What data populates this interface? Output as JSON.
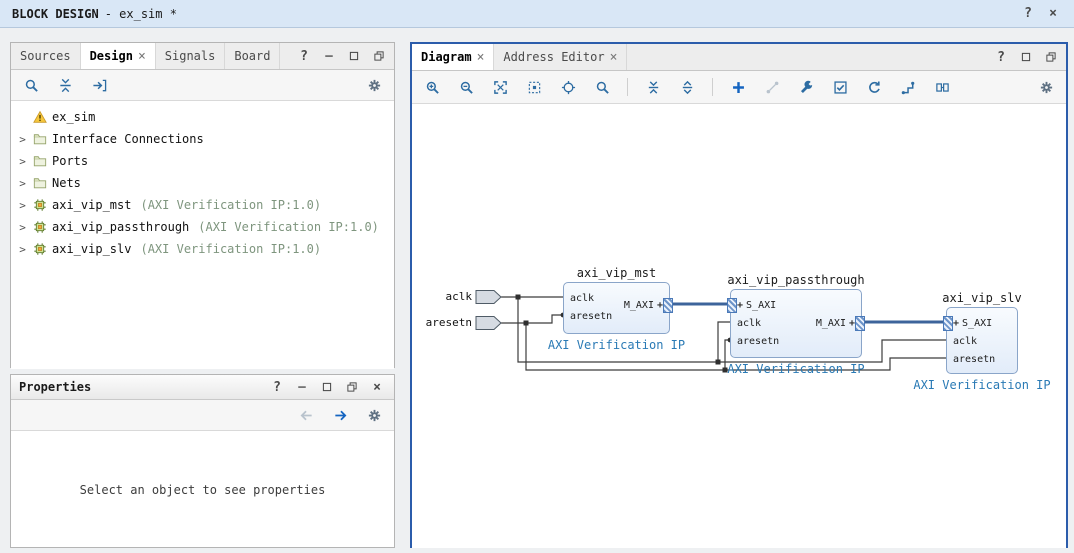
{
  "title_bar": {
    "title": "BLOCK DESIGN",
    "subtitle": "- ex_sim *",
    "controls": [
      "help-icon",
      "close-icon"
    ]
  },
  "design_panel": {
    "tabs": [
      {
        "label": "Sources",
        "active": false,
        "closable": false
      },
      {
        "label": "Design",
        "active": true,
        "closable": true
      },
      {
        "label": "Signals",
        "active": false,
        "closable": false
      },
      {
        "label": "Board",
        "active": false,
        "closable": false
      }
    ],
    "window_controls": [
      "help-icon",
      "minimize-icon",
      "maximize-icon",
      "float-icon"
    ],
    "toolbar": [
      {
        "icon": "search-icon",
        "name": "search"
      },
      {
        "icon": "collapse-all-icon",
        "name": "collapse-all"
      },
      {
        "icon": "scroll-to-icon",
        "name": "scroll-to"
      }
    ],
    "toolbar_right": [
      {
        "icon": "gear-icon",
        "name": "settings"
      }
    ],
    "tree": [
      {
        "label": "ex_sim",
        "icon": "design-warning-icon",
        "expander": false
      },
      {
        "label": "Interface Connections",
        "icon": "folder-icon",
        "expander": true
      },
      {
        "label": "Ports",
        "icon": "folder-icon",
        "expander": true
      },
      {
        "label": "Nets",
        "icon": "folder-icon",
        "expander": true
      },
      {
        "label": "axi_vip_mst",
        "annotation": "(AXI Verification IP:1.0)",
        "icon": "ip-icon",
        "expander": true
      },
      {
        "label": "axi_vip_passthrough",
        "annotation": "(AXI Verification IP:1.0)",
        "icon": "ip-icon",
        "expander": true
      },
      {
        "label": "axi_vip_slv",
        "annotation": "(AXI Verification IP:1.0)",
        "icon": "ip-icon",
        "expander": true
      }
    ]
  },
  "properties_panel": {
    "title": "Properties",
    "window_controls": [
      "help-icon",
      "minimize-icon",
      "maximize-icon",
      "float-icon",
      "close-icon"
    ],
    "toolbar_right": [
      {
        "icon": "back-icon",
        "name": "back",
        "disabled": true
      },
      {
        "icon": "forward-icon",
        "name": "forward",
        "accent": true
      },
      {
        "icon": "gear-icon",
        "name": "settings"
      }
    ],
    "placeholder": "Select an object to see properties"
  },
  "diagram_panel": {
    "tabs": [
      {
        "label": "Diagram",
        "active": true,
        "closable": true
      },
      {
        "label": "Address Editor",
        "active": false,
        "closable": true
      }
    ],
    "window_controls": [
      "help-icon",
      "maximize-icon",
      "float-icon"
    ],
    "toolbar": [
      {
        "icon": "zoom-in-icon",
        "name": "zoom-in"
      },
      {
        "icon": "zoom-out-icon",
        "name": "zoom-out"
      },
      {
        "icon": "zoom-fit-icon",
        "name": "zoom-fit"
      },
      {
        "icon": "zoom-selection-icon",
        "name": "zoom-to-selection"
      },
      {
        "icon": "target-icon",
        "name": "fit-selection"
      },
      {
        "icon": "search-icon",
        "name": "search"
      },
      {
        "sep": true
      },
      {
        "icon": "collapse-hierarchy-icon",
        "name": "collapse-hierarchy"
      },
      {
        "icon": "expand-hierarchy-icon",
        "name": "expand-hierarchy"
      },
      {
        "sep": true
      },
      {
        "icon": "add-ip-icon",
        "name": "add-ip",
        "accent": true
      },
      {
        "icon": "make-connection-icon",
        "name": "make-connection",
        "disabled": true
      },
      {
        "icon": "customize-icon",
        "name": "customize-block"
      },
      {
        "icon": "validate-icon",
        "name": "validate-design"
      },
      {
        "icon": "regenerate-icon",
        "name": "regenerate-layout"
      },
      {
        "icon": "route-icon",
        "name": "optimize-routing"
      },
      {
        "icon": "group-icon",
        "name": "show-interfaces"
      }
    ],
    "toolbar_right": [
      {
        "icon": "gear-icon",
        "name": "settings"
      }
    ],
    "external_ports": [
      {
        "label": "aclk"
      },
      {
        "label": "aresetn"
      }
    ],
    "blocks": [
      {
        "name": "axi_vip_mst",
        "type_label": "AXI Verification IP",
        "left_pins": [
          {
            "kind": "pin",
            "label": "aclk"
          },
          {
            "kind": "pin",
            "label": "aresetn"
          }
        ],
        "right_pins": [
          {
            "kind": "intf",
            "label": "M_AXI"
          }
        ]
      },
      {
        "name": "axi_vip_passthrough",
        "type_label": "AXI Verification IP",
        "left_pins": [
          {
            "kind": "intf",
            "label": "S_AXI"
          },
          {
            "kind": "pin",
            "label": "aclk"
          },
          {
            "kind": "pin",
            "label": "aresetn"
          }
        ],
        "right_pins": [
          {
            "kind": "intf",
            "label": "M_AXI"
          }
        ]
      },
      {
        "name": "axi_vip_slv",
        "type_label": "AXI Verification IP",
        "left_pins": [
          {
            "kind": "intf",
            "label": "S_AXI"
          },
          {
            "kind": "pin",
            "label": "aclk"
          },
          {
            "kind": "pin",
            "label": "aresetn"
          }
        ],
        "right_pins": []
      }
    ]
  }
}
